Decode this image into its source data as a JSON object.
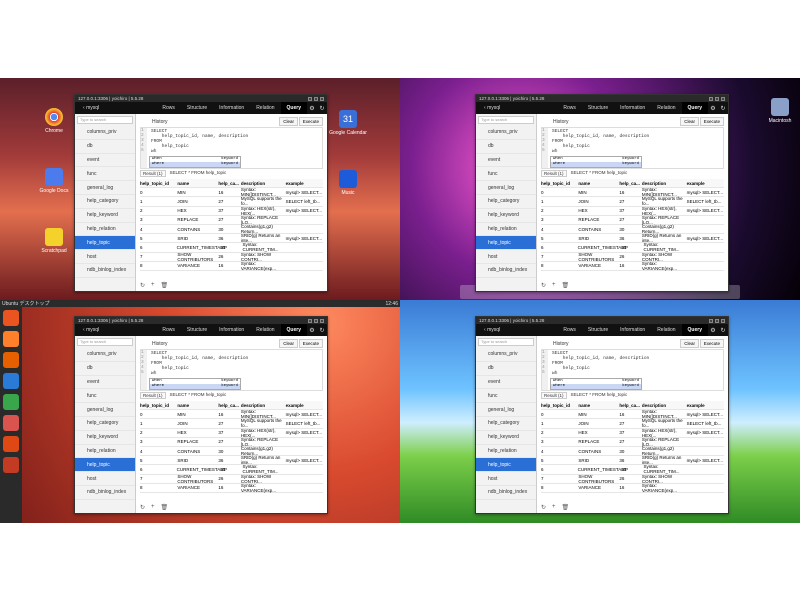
{
  "app": {
    "window_title": "127.0.0.1:3306 | yoichiro | 5.5.28",
    "db_name": "mysql",
    "tabs": [
      "Rows",
      "Structure",
      "Information",
      "Relation",
      "Query"
    ],
    "active_tab": "Query",
    "search_placeholder": "Type to search",
    "tables": [
      "columns_priv",
      "db",
      "event",
      "func",
      "general_log",
      "help_category",
      "help_keyword",
      "help_relation",
      "help_topic",
      "host",
      "ndb_binlog_index"
    ],
    "active_table": "help_topic",
    "history_label": "History",
    "clear_button": "Clear",
    "execute_button": "Execute",
    "editor_lines": [
      "1",
      "2",
      "3",
      "4",
      "5"
    ],
    "editor_code": "SELECT\n    help_topic_id, name, description\nFROM\n    help_topic\nwh",
    "autocomplete": [
      {
        "text": "when",
        "kind": "keyword"
      },
      {
        "text": "where",
        "kind": "keyword"
      }
    ],
    "result_select": "Result (1)",
    "result_query": "SELECT * FROM help_topic",
    "columns": [
      "help_topic_id",
      "name",
      "help_ca...",
      "description",
      "example"
    ],
    "rows": [
      [
        "0",
        "MIN",
        "16",
        "Syntax: MIN([DISTINCT...",
        "mysql> SELECT..."
      ],
      [
        "1",
        "JOIN",
        "27",
        "MySQL supports the fo...",
        "SELECT left_tb..."
      ],
      [
        "2",
        "HEX",
        "37",
        "Syntax: HEX(str), HEX(...",
        "mysql> SELECT..."
      ],
      [
        "3",
        "REPLACE",
        "27",
        "Syntax: REPLACE [LO...",
        ""
      ],
      [
        "4",
        "CONTAINS",
        "30",
        "Contains(g1,g2) Return...",
        ""
      ],
      [
        "5",
        "SRID",
        "36",
        "SRID(g) Returns an inte...",
        "mysql> SELECT..."
      ],
      [
        "6",
        "CURRENT_TIMESTAMP",
        "31",
        "Syntax: CURRENT_TIM...",
        ""
      ],
      [
        "7",
        "SHOW CONTRIBUTORS",
        "26",
        "Syntax: SHOW CONTRI...",
        ""
      ],
      [
        "8",
        "VARIANCE",
        "16",
        "Syntax: VARIANCE(exp...",
        ""
      ]
    ]
  },
  "desktop": {
    "windows_icons": [
      "Chrome",
      "Google Docs",
      "Scratchpad",
      "Google Calendar",
      "Music"
    ],
    "mac_icon": "Macintosh",
    "ubuntu_bar_left": "Ubuntu デスクトップ",
    "ubuntu_bar_right": "12:46",
    "calendar_number": "31"
  },
  "colors": {
    "accent": "#2a6fd6",
    "nav_bg": "#111111"
  }
}
